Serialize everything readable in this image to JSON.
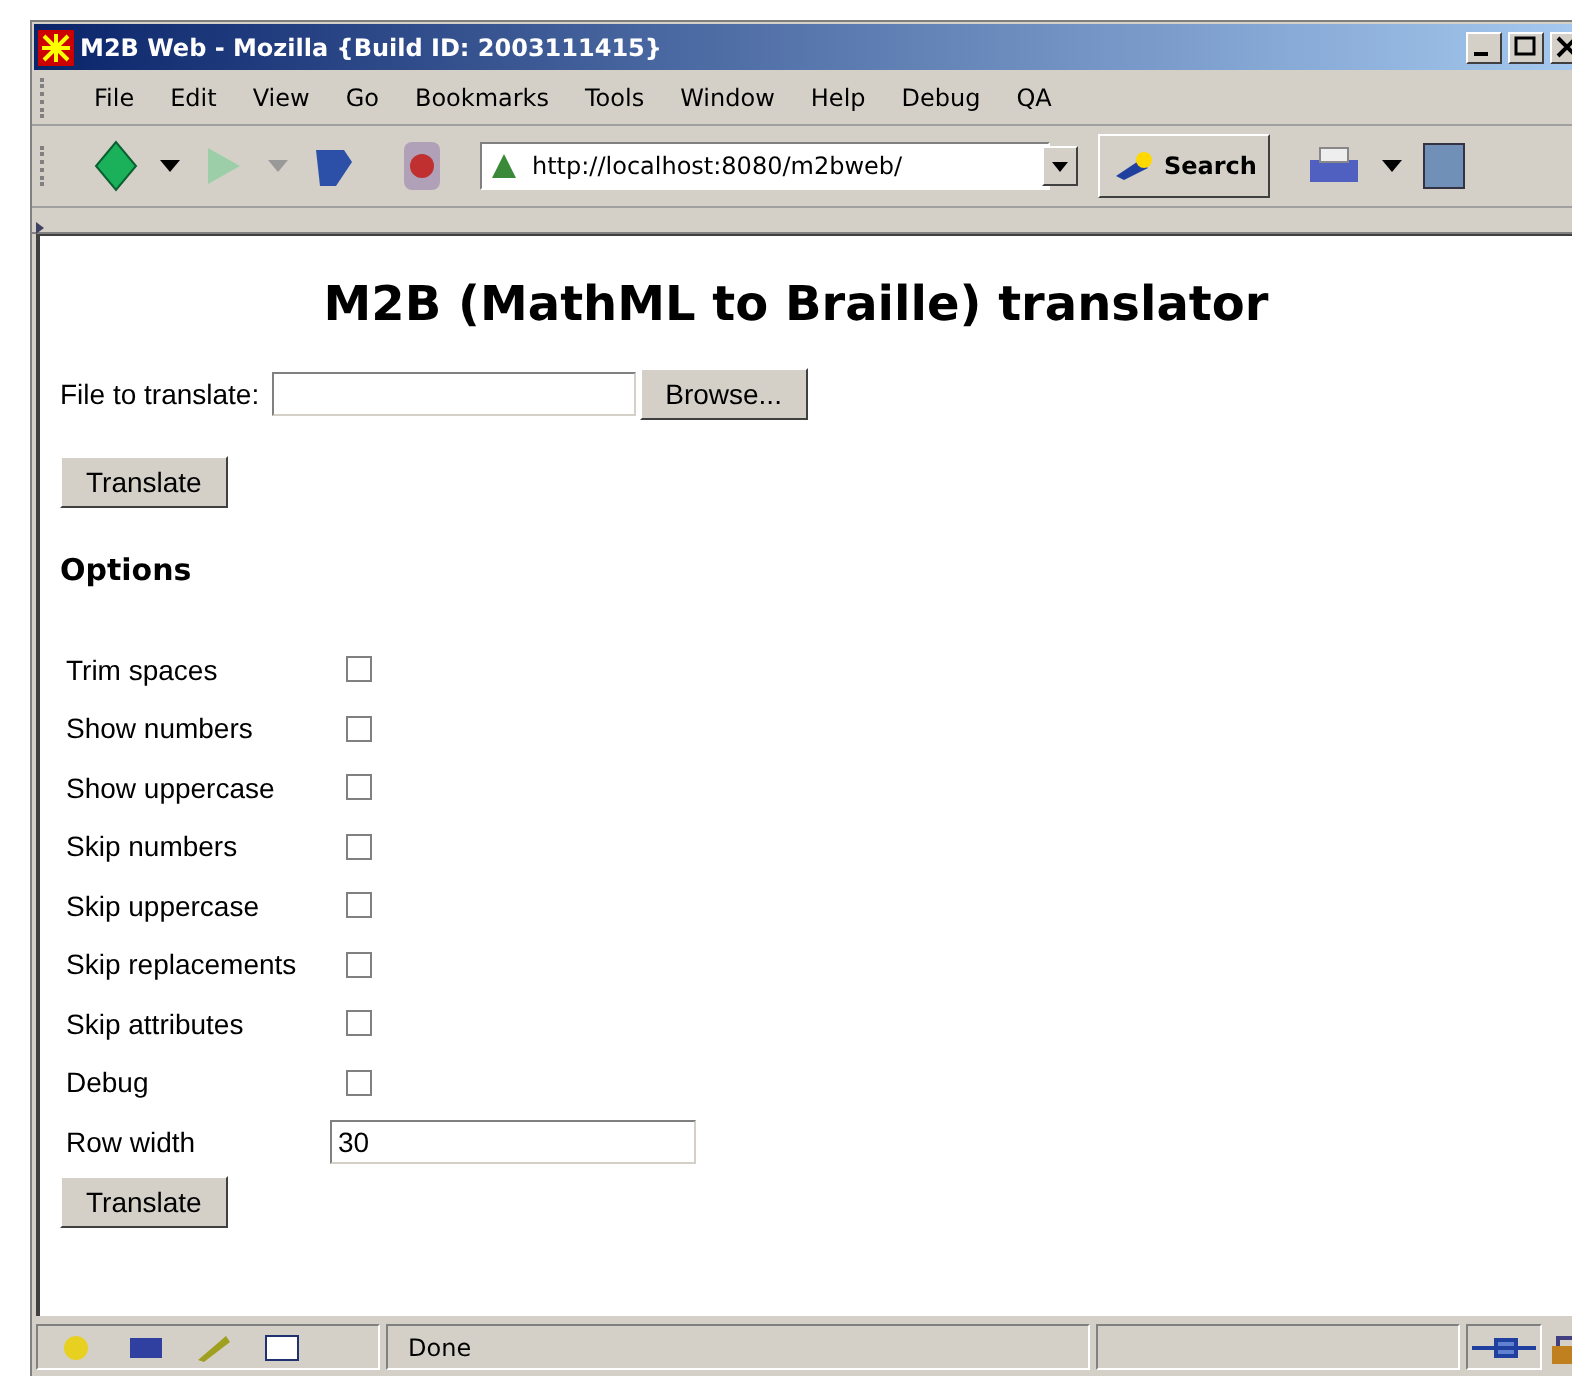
{
  "window": {
    "title": "M2B Web - Mozilla {Build ID: 2003111415}"
  },
  "menu": [
    "File",
    "Edit",
    "View",
    "Go",
    "Bookmarks",
    "Tools",
    "Window",
    "Help",
    "Debug",
    "QA"
  ],
  "toolbar": {
    "url": "http://localhost:8080/m2bweb/",
    "search_label": "Search"
  },
  "page": {
    "heading": "M2B (MathML to Braille) translator",
    "file_label": "File to translate:",
    "browse_button": "Browse...",
    "translate_button": "Translate",
    "options_title": "Options",
    "options": [
      {
        "label": "Trim spaces",
        "checked": false
      },
      {
        "label": "Show numbers",
        "checked": false
      },
      {
        "label": "Show uppercase",
        "checked": false
      },
      {
        "label": "Skip numbers",
        "checked": false
      },
      {
        "label": "Skip uppercase",
        "checked": false
      },
      {
        "label": "Skip replacements",
        "checked": false
      },
      {
        "label": "Skip attributes",
        "checked": false
      },
      {
        "label": "Debug",
        "checked": false
      }
    ],
    "row_width": {
      "label": "Row width",
      "value": "30"
    },
    "translate_button_2": "Translate"
  },
  "status_bar": {
    "text": "Done"
  }
}
